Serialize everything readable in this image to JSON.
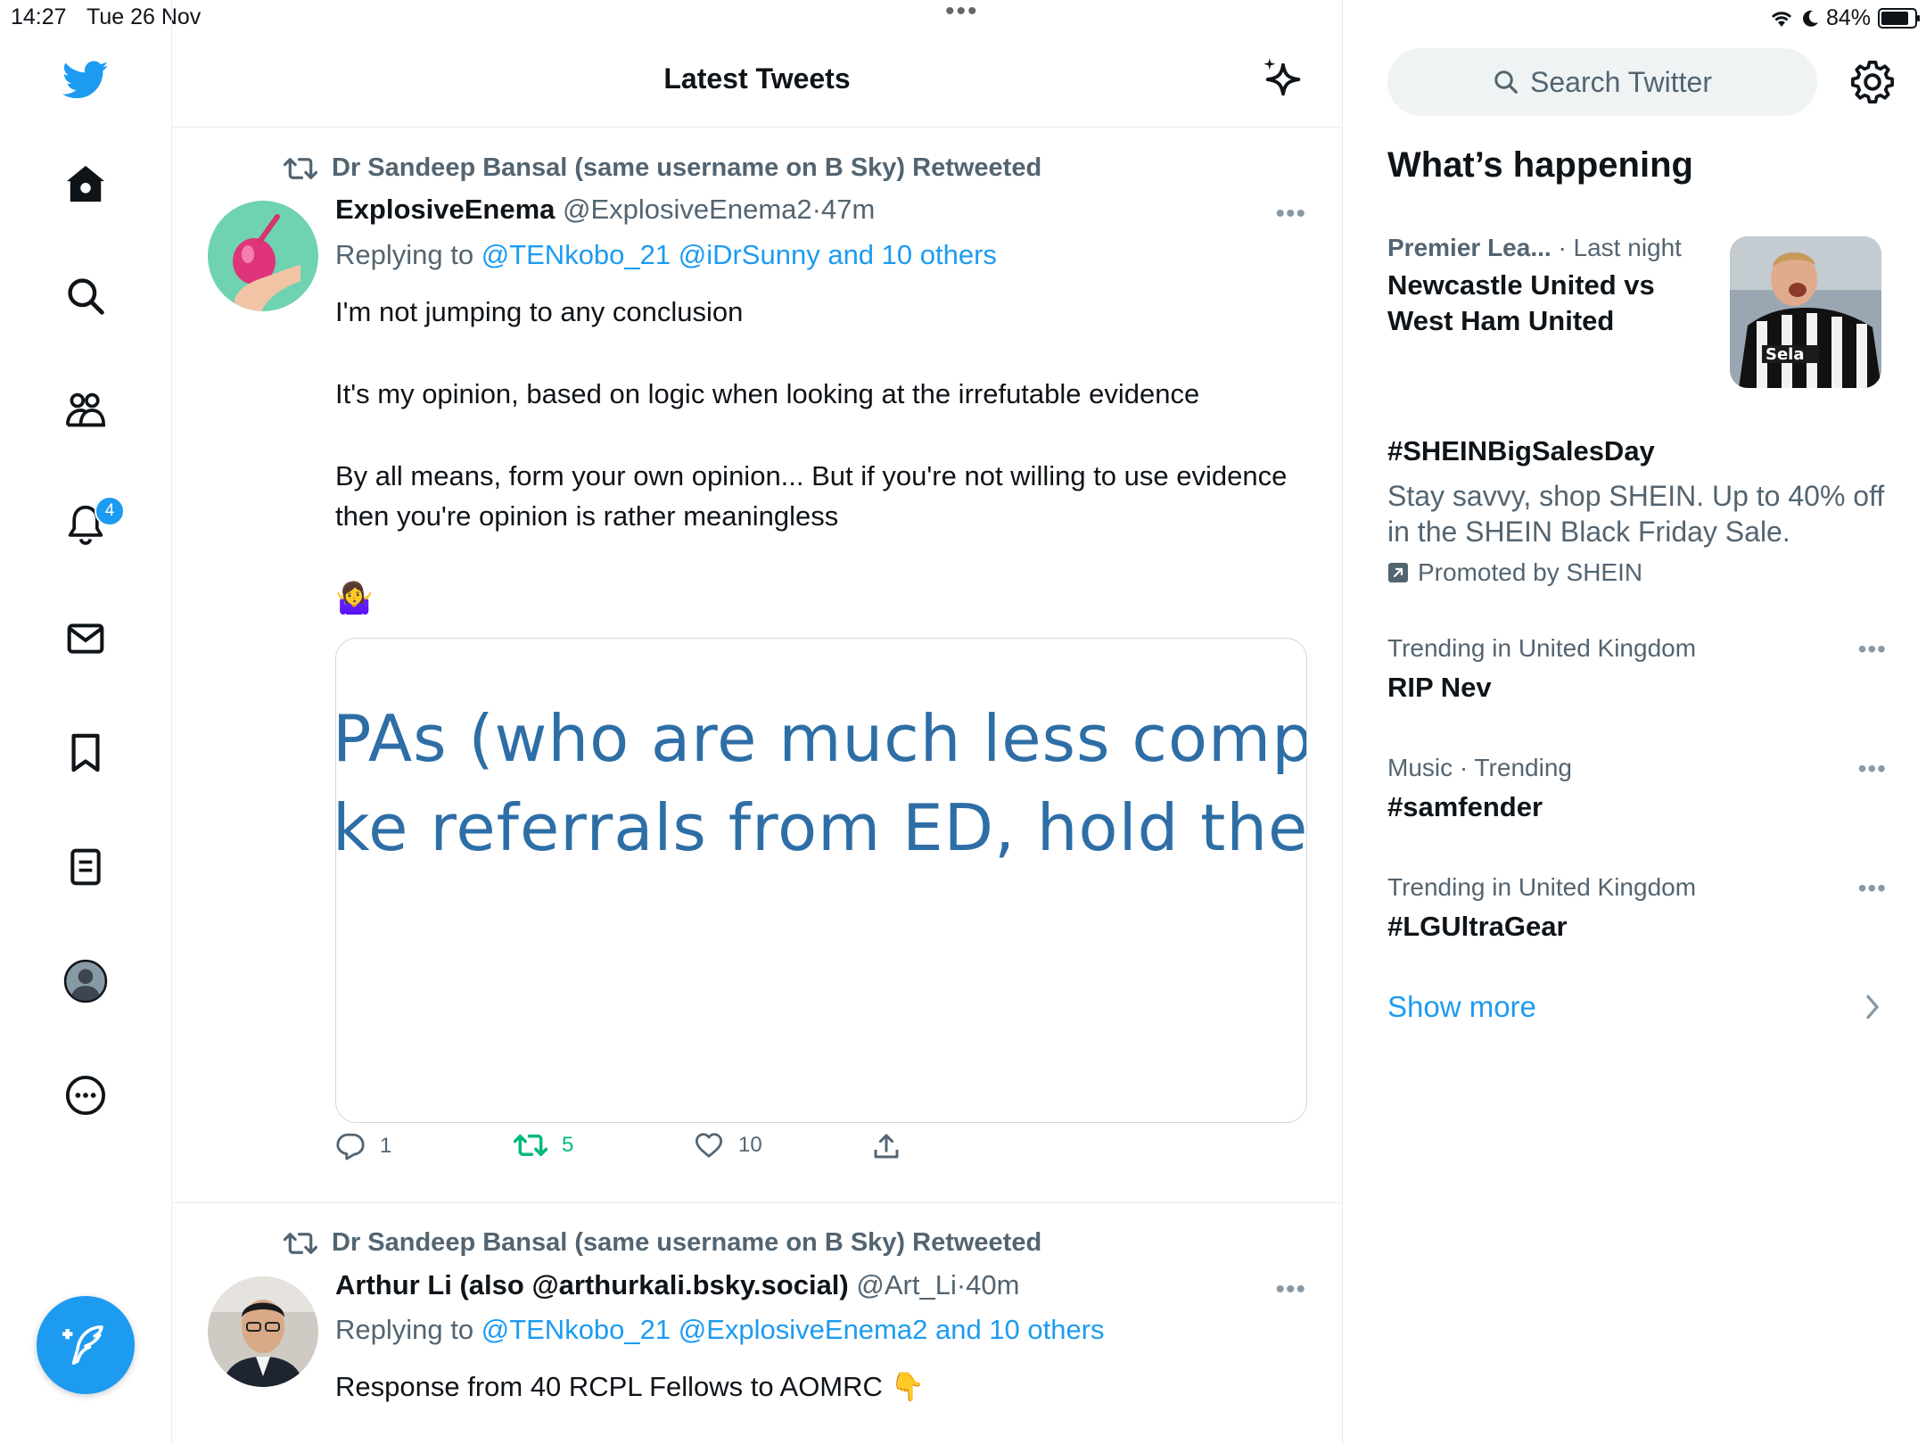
{
  "status_bar": {
    "time": "14:27",
    "date": "Tue 26 Nov",
    "battery": "84%"
  },
  "sidebar": {
    "notifications_badge": "4"
  },
  "header": {
    "title": "Latest Tweets"
  },
  "tweets": [
    {
      "retweeted_by": "Dr Sandeep Bansal (same username on B Sky) Retweeted",
      "name": "ExplosiveEnema",
      "handle": "@ExplosiveEnema2",
      "separator": "·",
      "time": "47m",
      "replying_prefix": "Replying to",
      "replying_to": "@TENkobo_21 @iDrSunny and 10 others",
      "paragraphs": [
        "I'm not jumping to any conclusion",
        "It's my opinion, based on logic when looking at the irrefutable evidence",
        "By all means, form your own opinion... But if you're not willing to use evidence then you're opinion is rather meaningless",
        "🤷‍♀️"
      ],
      "media_text": [
        "PAs (who are much less comp",
        "ke referrals from ED, hold the"
      ],
      "reply_count": "1",
      "retweet_count": "5",
      "like_count": "10"
    },
    {
      "retweeted_by": "Dr Sandeep Bansal (same username on B Sky) Retweeted",
      "name": "Arthur Li (also @arthurkali.bsky.social)",
      "handle": "@Art_Li",
      "separator": "·",
      "time": "40m",
      "replying_prefix": "Replying to",
      "replying_to": "@TENkobo_21 @ExplosiveEnema2 and 10 others",
      "paragraphs": [
        "Response from 40 RCPL Fellows to AOMRC 👇"
      ]
    }
  ],
  "right_panel": {
    "search_placeholder": "Search Twitter",
    "section_title": "What’s happening",
    "news": {
      "category": "Premier Lea...",
      "time": "· Last night",
      "title": "Newcastle United vs West Ham United",
      "image_text": "Sela"
    },
    "promoted": {
      "title": "#SHEINBigSalesDay",
      "description": "Stay savvy, shop SHEIN. Up to 40% off in the SHEIN Black Friday Sale.",
      "promoted_by": "Promoted by SHEIN"
    },
    "trends": [
      {
        "meta": "Trending in United Kingdom",
        "title": "RIP Nev"
      },
      {
        "meta": "Music · Trending",
        "title": "#samfender"
      },
      {
        "meta": "Trending in United Kingdom",
        "title": "#LGUltraGear"
      }
    ],
    "show_more": "Show more"
  },
  "colors": {
    "accent": "#1d9bf0",
    "retweet": "#00ba7c",
    "secondary_text": "#536471",
    "border": "#e6ecf0"
  }
}
